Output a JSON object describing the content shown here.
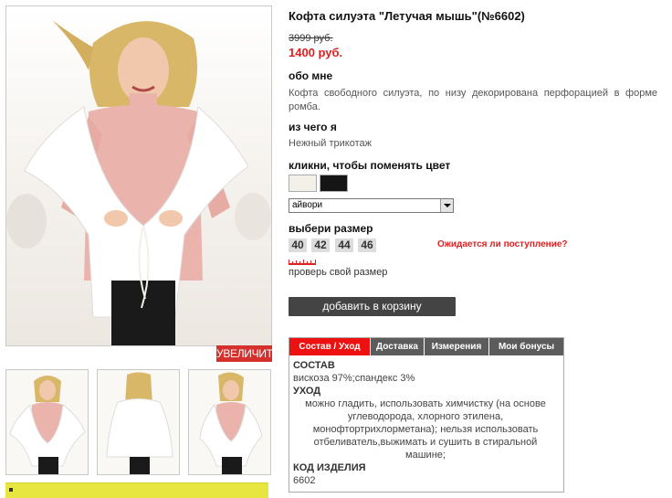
{
  "product": {
    "title": "Кофта силуэта \"Летучая мышь\"(№6602)",
    "old_price": "3999 руб.",
    "new_price": "1400 руб."
  },
  "gallery": {
    "zoom_label": "УВЕЛИЧИТЬ",
    "thumbnails": [
      "front-view",
      "back-view",
      "side-view"
    ]
  },
  "about": {
    "heading": "обо мне",
    "text": "Кофта свободного силуэта, по низу декорирована перфорацией в форме ромба."
  },
  "material": {
    "heading": "из чего я",
    "text": "Нежный трикотаж"
  },
  "color": {
    "heading": "кликни, чтобы поменять цвет",
    "swatches": [
      {
        "name": "айвори",
        "hex": "#f3f0ea"
      },
      {
        "name": "черный",
        "hex": "#151515"
      }
    ],
    "selected": "айвори"
  },
  "size": {
    "heading": "выбери размер",
    "options": [
      "40",
      "42",
      "44",
      "46"
    ],
    "waiting_link": "Ожидается ли поступление?",
    "check_link": "проверь свой размер",
    "ruler_icon": "ruler-icon"
  },
  "cart": {
    "button_label": "добавить в корзину"
  },
  "tabs": {
    "items": [
      "Состав / Уход",
      "Доставка",
      "Измерения",
      "Мои бонусы"
    ],
    "active": "Состав / Уход",
    "content": {
      "composition_heading": "СОСТАВ",
      "composition_text": "вискоза 97%;спандекс 3%",
      "care_heading": "УХОД",
      "care_text": "можно гладить, использовать химчистку (на основе углеводорода, хлорного этилена, монофтортрихлорметана); нельзя использовать отбеливатель,выжимать и сушить в стиральной машине;",
      "code_heading": "КОД ИЗДЕЛИЯ",
      "code_value": "6602"
    }
  },
  "colors": {
    "accent_red": "#e02020",
    "tab_active": "#ee1111",
    "tab_inactive": "#5c5c5c",
    "cart_button": "#444444",
    "size_button": "#dcdcdc",
    "promo_strip": "#e7e640"
  }
}
